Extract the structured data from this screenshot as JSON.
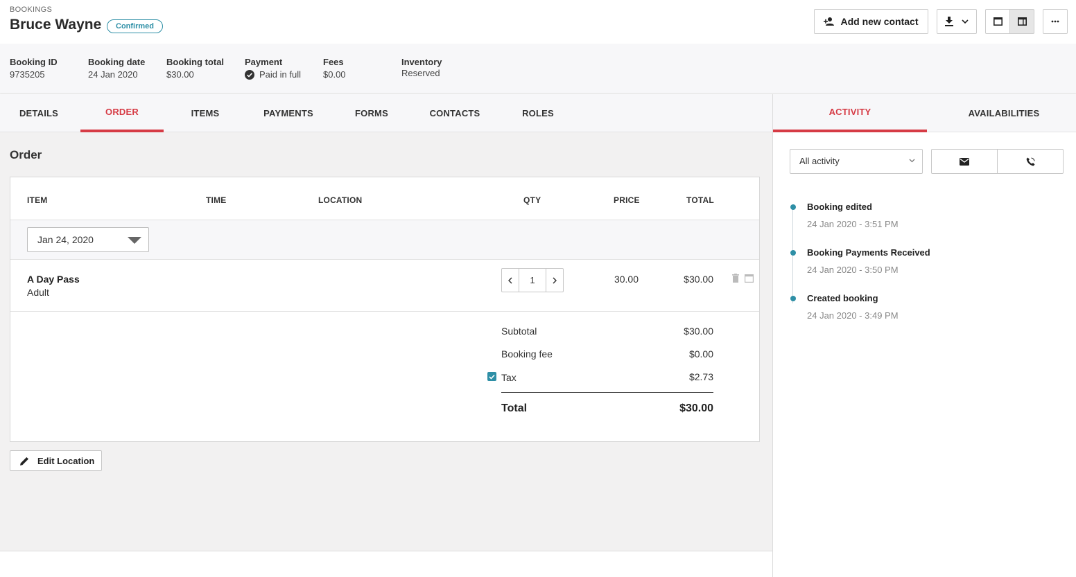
{
  "header": {
    "breadcrumb": "BOOKINGS",
    "title": "Bruce Wayne",
    "status_badge": "Confirmed",
    "add_contact_label": "Add new contact"
  },
  "summary": [
    {
      "label": "Booking ID",
      "value": "9735205"
    },
    {
      "label": "Booking date",
      "value": "24 Jan 2020"
    },
    {
      "label": "Booking total",
      "value": "$30.00"
    },
    {
      "label": "Payment",
      "value": "Paid in full"
    },
    {
      "label": "Fees",
      "value": "$0.00"
    },
    {
      "label": "Inventory",
      "value": "Reserved"
    }
  ],
  "tabs": [
    {
      "label": "DETAILS",
      "active": false
    },
    {
      "label": "ORDER",
      "active": true
    },
    {
      "label": "ITEMS",
      "active": false
    },
    {
      "label": "PAYMENTS",
      "active": false
    },
    {
      "label": "FORMS",
      "active": false
    },
    {
      "label": "CONTACTS",
      "active": false
    },
    {
      "label": "ROLES",
      "active": false
    }
  ],
  "order": {
    "title": "Order",
    "columns": [
      "ITEM",
      "TIME",
      "LOCATION",
      "QTY",
      "PRICE",
      "TOTAL"
    ],
    "date_filter": "Jan 24, 2020",
    "items": [
      {
        "name": "A Day Pass",
        "variant": "Adult",
        "qty": "1",
        "price": "30.00",
        "total": "$30.00"
      }
    ],
    "subtotal_label": "Subtotal",
    "subtotal": "$30.00",
    "booking_fee_label": "Booking fee",
    "booking_fee": "$0.00",
    "tax_label": "Tax",
    "tax": "$2.73",
    "total_label": "Total",
    "total": "$30.00",
    "edit_location_label": "Edit Location"
  },
  "right_tabs": [
    {
      "label": "ACTIVITY",
      "active": true
    },
    {
      "label": "AVAILABILITIES",
      "active": false
    }
  ],
  "activity": {
    "filter": "All activity",
    "events": [
      {
        "title": "Booking edited",
        "time": "24 Jan 2020 - 3:51 PM"
      },
      {
        "title": "Booking Payments Received",
        "time": "24 Jan 2020 - 3:50 PM"
      },
      {
        "title": "Created booking",
        "time": "24 Jan 2020 - 3:49 PM"
      }
    ]
  },
  "colors": {
    "accent": "#d63b45",
    "teal": "#2e8fa6"
  },
  "icons": {
    "add_contact": "add-person-icon",
    "download": "download-icon",
    "payment_status": "check-circle-icon",
    "edit": "pencil-icon",
    "email": "envelope-icon",
    "phone": "phone-icon"
  }
}
